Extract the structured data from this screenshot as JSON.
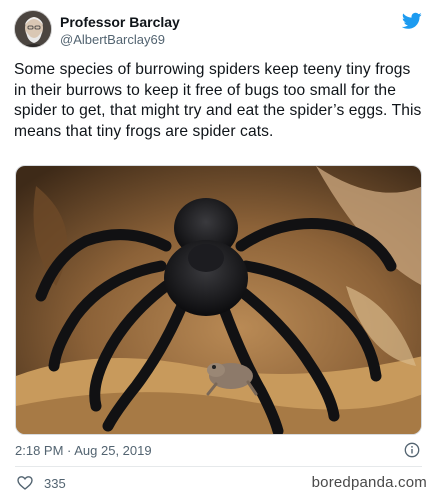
{
  "tweet": {
    "author_name": "Professor Barclay",
    "author_handle": "@AlbertBarclay69",
    "text": "Some species of burrowing spiders keep teeny tiny frogs in their burrows to keep it free of bugs too small for the spider to get, that might try and eat the spider’s eggs. This means that tiny frogs are spider cats.",
    "timestamp": "2:18 PM · Aug 25, 2019",
    "like_count": "335"
  },
  "watermark": "boredpanda.com",
  "icons": {
    "platform": "twitter-bird-icon",
    "info": "info-icon",
    "like": "heart-icon"
  },
  "colors": {
    "brand": "#1d9bf0",
    "secondary_text": "#536471",
    "primary_text": "#0f1419"
  }
}
